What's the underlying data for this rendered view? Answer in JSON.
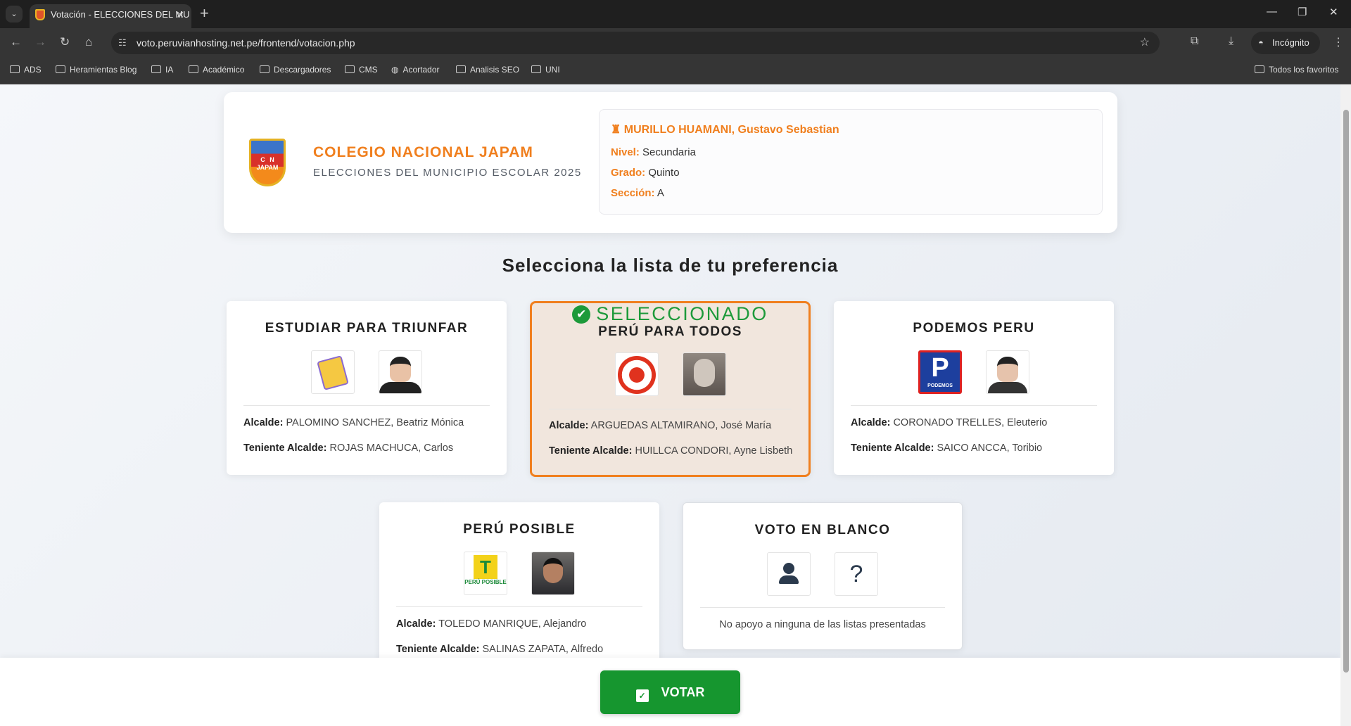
{
  "browser": {
    "tab_title": "Votación - ELECCIONES DEL MU",
    "url": "voto.peruvianhosting.net.pe/frontend/votacion.php",
    "profile": "Incógnito",
    "bookmarks": [
      "ADS",
      "Heramientas Blog",
      "IA",
      "Académico",
      "Descargadores",
      "CMS",
      "Acortador",
      "Analisis SEO",
      "UNI"
    ],
    "all_bookmarks": "Todos los favoritos"
  },
  "header": {
    "school": "COLEGIO NACIONAL JAPAM",
    "subtitle": "ELECCIONES DEL MUNICIPIO ESCOLAR 2025",
    "crest_text": "C N JAPAM"
  },
  "student": {
    "name": "MURILLO HUAMANI, Gustavo Sebastian",
    "nivel_label": "Nivel:",
    "nivel": "Secundaria",
    "grado_label": "Grado:",
    "grado": "Quinto",
    "seccion_label": "Sección:",
    "seccion": "A"
  },
  "heading": "Selecciona la lista de tu preferencia",
  "labels": {
    "alcalde": "Alcalde:",
    "teniente": "Teniente Alcalde:",
    "selected": "SELECCIONADO"
  },
  "lists": [
    {
      "name": "ESTUDIAR PARA TRIUNFAR",
      "alcalde": "PALOMINO SANCHEZ, Beatriz Mónica",
      "teniente": "ROJAS MACHUCA, Carlos"
    },
    {
      "name": "PERÚ PARA TODOS",
      "alcalde": "ARGUEDAS ALTAMIRANO, José María",
      "teniente": "HUILLCA CONDORI, Ayne Lisbeth",
      "selected": true
    },
    {
      "name": "PODEMOS PERU",
      "alcalde": "CORONADO TRELLES, Eleuterio",
      "teniente": "SAICO ANCCA, Toribio",
      "logo_text": "PODEMOS"
    },
    {
      "name": "PERÚ POSIBLE",
      "alcalde": "TOLEDO MANRIQUE, Alejandro",
      "teniente": "SALINAS ZAPATA, Alfredo",
      "logo_text": "PERÚ POSIBLE"
    }
  ],
  "blank": {
    "name": "VOTO EN BLANCO",
    "text": "No apoyo a ninguna de las listas presentadas"
  },
  "vote_button": "VOTAR",
  "colors": {
    "accent": "#f07f1e",
    "success": "#16962f"
  }
}
